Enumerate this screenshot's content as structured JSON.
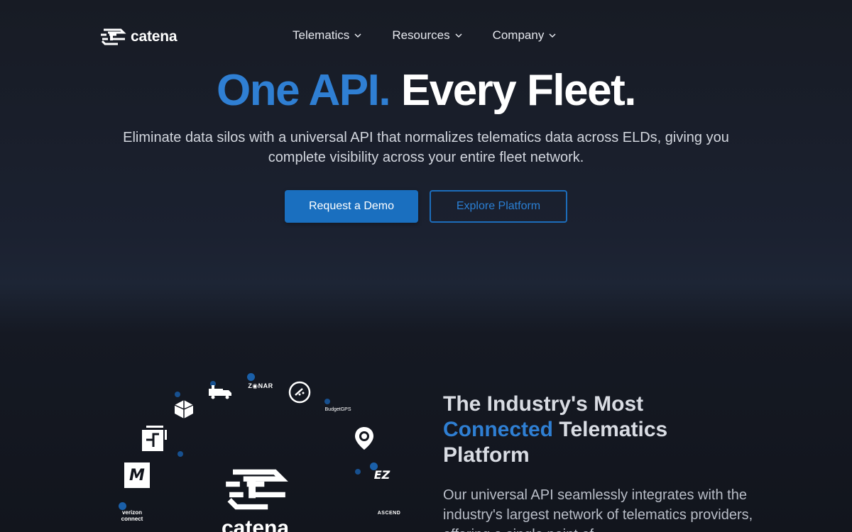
{
  "brand": {
    "name": "catena"
  },
  "nav": {
    "items": [
      {
        "label": "Telematics"
      },
      {
        "label": "Resources"
      },
      {
        "label": "Company"
      }
    ]
  },
  "hero": {
    "title_accent": "One API.",
    "title_rest": "Every Fleet.",
    "subtitle": "Eliminate data silos with a universal API that normalizes telematics data across ELDs, giving you complete visibility across your entire fleet network.",
    "primary_cta": "Request a Demo",
    "secondary_cta": "Explore Platform"
  },
  "integrations": {
    "center_label": "catena",
    "partners": {
      "zonar": "Z◉NAR",
      "budgetgps": "BudgetGPS",
      "verizon_line1": "verizon",
      "verizon_line2": "connect",
      "ascend": "ASCEND",
      "motive": "M",
      "ez": "EZ"
    }
  },
  "section": {
    "title_part1": "The Industry's Most",
    "title_accent": "Connected",
    "title_part2": "Telematics Platform",
    "body": "Our universal API seamlessly integrates with the industry's largest network of telematics providers, offering a single point of"
  },
  "colors": {
    "accent": "#2f7fd3",
    "primary_button": "#1a6fbf",
    "background": "#161a23"
  }
}
